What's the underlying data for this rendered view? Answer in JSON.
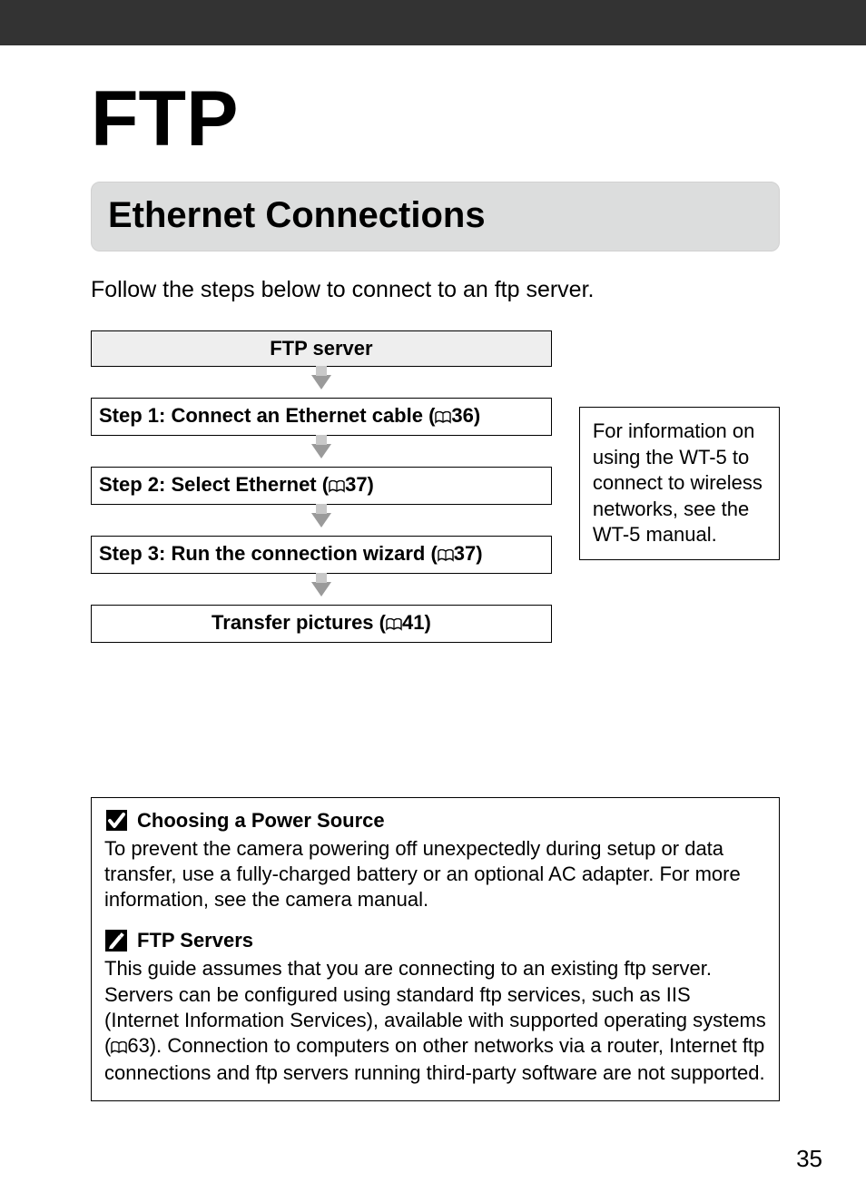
{
  "chapter_title": "FTP",
  "section_title": "Ethernet Connections",
  "intro_text": "Follow the steps below to connect to an ftp server.",
  "flow": {
    "start_label": "FTP server",
    "step1_prefix": "Step 1: Connect an Ethernet cable (",
    "step1_page": "36)",
    "step2_prefix": "Step 2: Select Ethernet (",
    "step2_page": "37)",
    "step3_prefix": "Step 3: Run the connection wizard (",
    "step3_page": "37)",
    "end_prefix": "Transfer pictures (",
    "end_page": "41)"
  },
  "side_note": "For information on using the WT-5 to connect to wireless networks, see the WT-5 manual.",
  "notes": {
    "n1_title": "Choosing a Power Source",
    "n1_body": "To prevent the camera powering off unexpectedly during setup or data transfer, use a fully-charged battery or an optional AC adapter. For more information, see the camera manual.",
    "n2_title": "FTP Servers",
    "n2_body_a": "This guide assumes that you are connecting to an existing ftp server. Servers can be configured using standard ftp services, such as IIS (Internet Information Services), available with supported operating systems (",
    "n2_body_page": "63). ",
    "n2_body_b": "Connection to computers on other networks via a router, Internet ftp connections and ftp servers running third-party software are not supported."
  },
  "page_number": "35"
}
